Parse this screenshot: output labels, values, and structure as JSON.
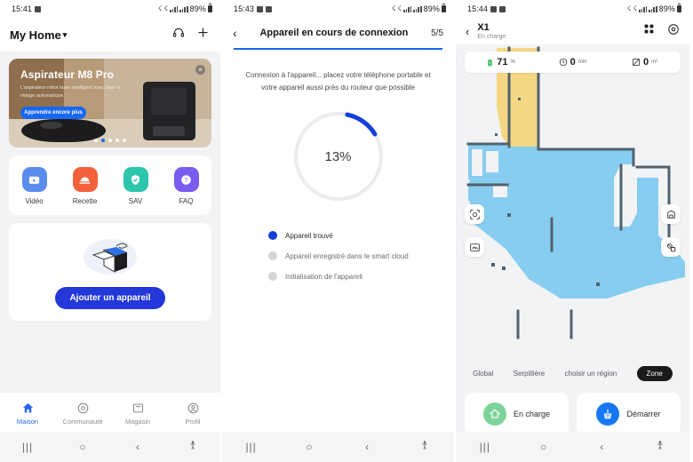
{
  "phone1": {
    "status": {
      "time": "15:41",
      "battery": "89%"
    },
    "header": {
      "title": "My Home",
      "chevron": "chevron-down-icon",
      "support_icon": "headset-icon",
      "add_icon": "plus-icon"
    },
    "banner": {
      "title": "Aspirateur M8 Pro",
      "subtitle": "L'aspirateur robot laser intelligent avec base à vidage automatique",
      "cta": "Apprendre encore plus",
      "close": "×",
      "dots": 5,
      "active_dot": 1
    },
    "quick_actions": [
      {
        "label": "Vidéo",
        "icon": "video-icon",
        "color": "#5b8def"
      },
      {
        "label": "Recette",
        "icon": "recipe-icon",
        "color": "#f3613c"
      },
      {
        "label": "SAV",
        "icon": "support-shield-icon",
        "color": "#2cc5ad"
      },
      {
        "label": "FAQ",
        "icon": "question-icon",
        "color": "#7a5cf0"
      }
    ],
    "add_device": {
      "label": "Ajouter un appareil",
      "illustration": "open-box-icon"
    },
    "tabs": [
      {
        "label": "Maison",
        "icon": "home-icon",
        "active": true
      },
      {
        "label": "Communauté",
        "icon": "community-icon",
        "active": false
      },
      {
        "label": "Magasin",
        "icon": "store-icon",
        "active": false
      },
      {
        "label": "Profil",
        "icon": "profile-icon",
        "active": false
      }
    ]
  },
  "phone2": {
    "status": {
      "time": "15:43",
      "battery": "89%"
    },
    "header": {
      "back": "‹",
      "title": "Appareil en cours de connexion",
      "step": "5/5",
      "progress_pct": 100
    },
    "description": "Connexion à l'appareil... placez votre téléphone portable et votre appareil aussi près du routeur que possible",
    "progress": {
      "percent_label": "13%",
      "value": 13,
      "track_color": "#ececef",
      "arc_color": "#1340d8"
    },
    "steps": [
      {
        "label": "Appareil trouvé",
        "active": true
      },
      {
        "label": "Appareil enregistré dans le smart cloud",
        "active": false
      },
      {
        "label": "Initialisation de l'appareil",
        "active": false
      }
    ]
  },
  "phone3": {
    "status": {
      "time": "15:44",
      "battery": "89%"
    },
    "header": {
      "back": "‹",
      "device_name": "X1",
      "device_state": "En charge",
      "grid_icon": "grid-icon",
      "settings_icon": "settings-icon"
    },
    "stats": [
      {
        "icon": "battery-icon",
        "value": "71",
        "unit": "%"
      },
      {
        "icon": "clock-icon",
        "value": "0",
        "unit": "min"
      },
      {
        "icon": "area-icon",
        "value": "0",
        "unit": "m²"
      }
    ],
    "map": {
      "floor_color": "#87cdf0",
      "room_color": "#f5d783",
      "wall_color": "#51616e",
      "background": "#f2f3f5"
    },
    "map_controls": [
      {
        "name": "locate-robot-icon",
        "pos": "top-left"
      },
      {
        "name": "map-edit-icon",
        "pos": "bottom-left"
      },
      {
        "name": "map-save-icon",
        "pos": "top-right"
      },
      {
        "name": "no-go-zone-icon",
        "pos": "bottom-right"
      }
    ],
    "modes": [
      {
        "label": "Global",
        "active": false
      },
      {
        "label": "Serpillière",
        "active": false
      },
      {
        "label": "choisir un région",
        "active": false
      },
      {
        "label": "Zone",
        "active": true
      }
    ],
    "actions": [
      {
        "label": "En charge",
        "icon": "dock-home-icon",
        "color": "#7ed39a"
      },
      {
        "label": "Démarrer",
        "icon": "clean-broom-icon",
        "color": "#1877f2"
      }
    ]
  },
  "navbar": {
    "recents": "|||",
    "home": "○",
    "back": "‹",
    "accessibility": "accessibility-icon"
  }
}
